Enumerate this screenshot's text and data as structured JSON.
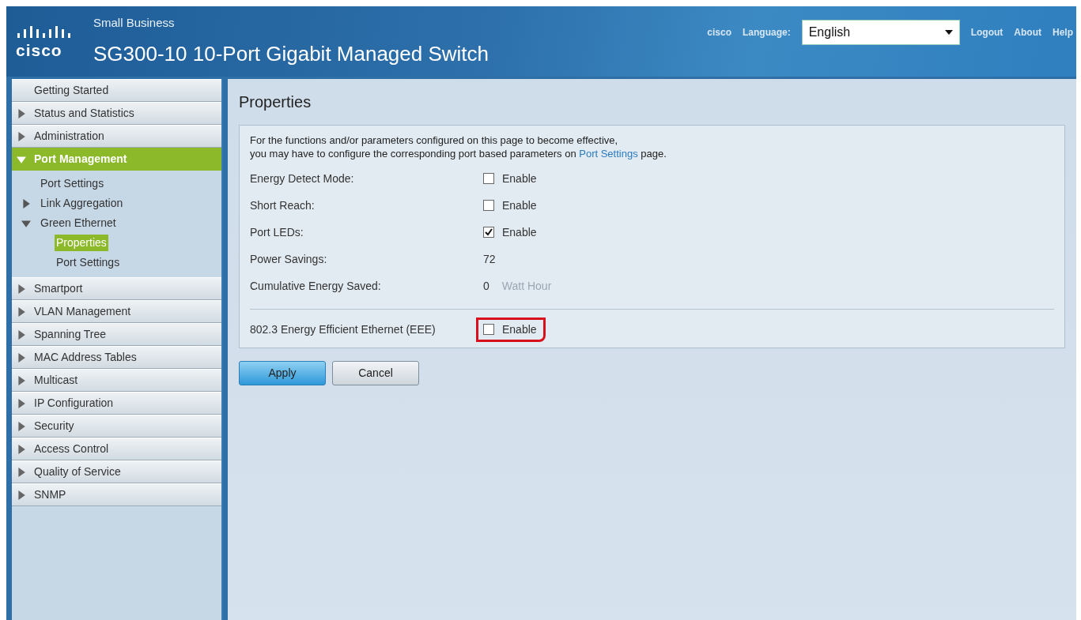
{
  "header": {
    "logo_word": "cisco",
    "product_line": "Small Business",
    "title": "SG300-10 10-Port Gigabit Managed Switch",
    "user": "cisco",
    "language_label": "Language:",
    "language": {
      "value": "English"
    },
    "links": [
      "Logout",
      "About",
      "Help"
    ]
  },
  "sidebar": {
    "items": [
      {
        "label": "Getting Started",
        "selected": false
      },
      {
        "label": "Status and Statistics",
        "expanded": false,
        "selected": false
      },
      {
        "label": "Administration",
        "expanded": false,
        "selected": false
      },
      {
        "label": "Port Management",
        "expanded": true,
        "selected": true,
        "children": [
          {
            "label": "Port Settings",
            "selected": false
          },
          {
            "label": "Link Aggregation",
            "expanded": false,
            "selected": false
          },
          {
            "label": "Green Ethernet",
            "expanded": true,
            "selected": false,
            "children": [
              {
                "label": "Properties",
                "selected": true
              },
              {
                "label": "Port Settings",
                "selected": false
              }
            ]
          }
        ]
      },
      {
        "label": "Smartport",
        "expanded": false,
        "selected": false
      },
      {
        "label": "VLAN Management",
        "expanded": false,
        "selected": false
      },
      {
        "label": "Spanning Tree",
        "expanded": false,
        "selected": false
      },
      {
        "label": "MAC Address Tables",
        "expanded": false,
        "selected": false
      },
      {
        "label": "Multicast",
        "expanded": false,
        "selected": false
      },
      {
        "label": "IP Configuration",
        "expanded": false,
        "selected": false
      },
      {
        "label": "Security",
        "expanded": false,
        "selected": false
      },
      {
        "label": "Access Control",
        "expanded": false,
        "selected": false
      },
      {
        "label": "Quality of Service",
        "expanded": false,
        "selected": false
      },
      {
        "label": "SNMP",
        "expanded": false,
        "selected": false
      }
    ]
  },
  "content": {
    "title": "Properties",
    "note": {
      "text_before": "For the functions and/or parameters configured on this page to become effective,\nyou may have to configure the corresponding port based parameters on ",
      "link": "Port Settings",
      "text_after": " page."
    },
    "fields": [
      {
        "label": "Energy Detect Mode:",
        "kind": "checkbox",
        "checked": false,
        "option": "Enable"
      },
      {
        "label": "Short Reach:",
        "kind": "checkbox",
        "checked": false,
        "option": "Enable"
      },
      {
        "label": "Port LEDs:",
        "kind": "checkbox",
        "checked": true,
        "option": "Enable"
      },
      {
        "label": "Power Savings:",
        "kind": "value",
        "value": "72"
      },
      {
        "label": "Cumulative Energy Saved:",
        "kind": "value",
        "value": "0",
        "unit": "Watt Hour"
      },
      {
        "label": "802.3 Energy Efficient Ethernet (EEE)",
        "kind": "checkbox",
        "checked": false,
        "option": "Enable",
        "highlighted": true,
        "separated": true
      }
    ],
    "buttons": [
      {
        "label": "Apply",
        "kind": "primary"
      },
      {
        "label": "Cancel",
        "kind": "secondary"
      }
    ]
  }
}
